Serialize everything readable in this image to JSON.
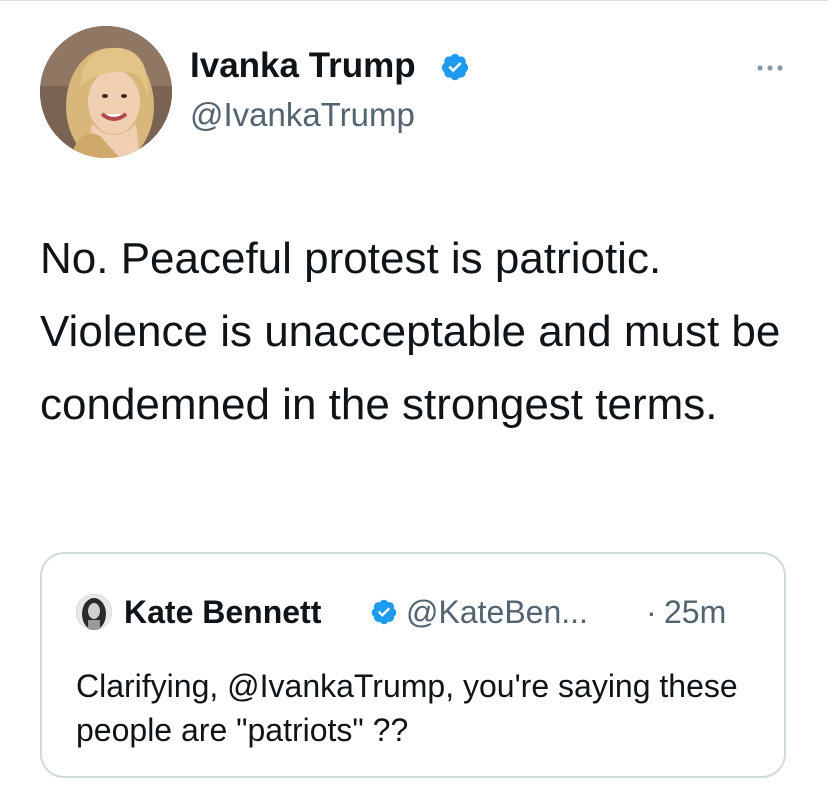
{
  "colors": {
    "text_primary": "#0f1419",
    "text_secondary": "#536471",
    "verified_blue": "#1d9bf0",
    "border": "#cfd9de"
  },
  "tweet": {
    "author": {
      "display_name": "Ivanka Trump",
      "handle": "@IvankaTrump",
      "verified": true,
      "avatar_icon": "profile-photo"
    },
    "more_icon": "ellipsis-icon",
    "text": "No. Peaceful protest is patriotic. Violence is unacceptable and must be condemned in the strongest terms."
  },
  "quoted_tweet": {
    "author": {
      "display_name": "Kate Bennett",
      "handle": "@KateBen...",
      "verified": true,
      "avatar_icon": "profile-photo"
    },
    "separator": "·",
    "timestamp": "25m",
    "text": "Clarifying, @IvankaTrump, you're saying these people are \"patriots\" ??"
  }
}
